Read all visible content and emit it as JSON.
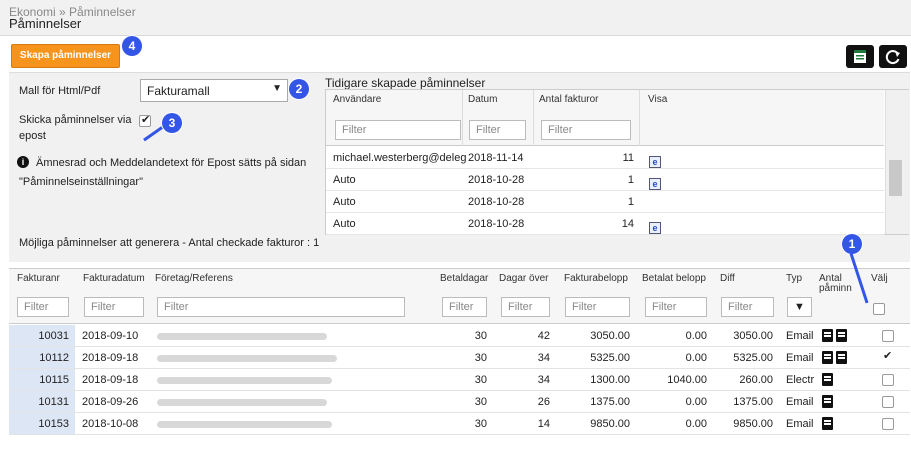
{
  "breadcrumb": "Ekonomi » Påminnelser",
  "page_title": "Påminnelser",
  "create_button": "Skapa påminnelser",
  "settings": {
    "template_label": "Mall för Html/Pdf",
    "template_value": "Fakturamall",
    "email_label_1": "Skicka påminnelser via",
    "email_label_2": "epost",
    "info_line_1": "Ämnesrad och Meddelandetext för Epost sätts på sidan",
    "info_line_2": "\"Påminnelseinställningar\"",
    "possible_label": "Möjliga påminnelser att generera - Antal checkade fakturor : 1"
  },
  "previous": {
    "title": "Tidigare skapade påminnelser",
    "columns": [
      "Användare",
      "Datum",
      "Antal fakturor",
      "Visa"
    ],
    "filter_placeholder": "Filter",
    "rows": [
      {
        "user": "michael.westerberg@deleg",
        "date": "2018-11-14",
        "count": "11",
        "icon": true
      },
      {
        "user": "Auto",
        "date": "2018-10-28",
        "count": "1",
        "icon": true
      },
      {
        "user": "Auto",
        "date": "2018-10-28",
        "count": "1",
        "icon": false
      },
      {
        "user": "Auto",
        "date": "2018-10-28",
        "count": "14",
        "icon": true
      }
    ]
  },
  "main": {
    "columns": {
      "nr": "Fakturanr",
      "date": "Fakturadatum",
      "company": "Företag/Referens",
      "paydays": "Betaldagar",
      "overdue": "Dagar över",
      "amount": "Fakturabelopp",
      "paid": "Betalat belopp",
      "diff": "Diff",
      "type": "Typ",
      "reminders_1": "Antal",
      "reminders_2": "påminn",
      "select": "Välj"
    },
    "filter_placeholder": "Filter",
    "type_filter_symbol": "▼",
    "rows": [
      {
        "nr": "10031",
        "date": "2018-09-10",
        "paydays": "30",
        "overdue": "42",
        "amount": "3050.00",
        "paid": "0.00",
        "diff": "3050.00",
        "type": "Email",
        "pdfs": 2,
        "checked": false
      },
      {
        "nr": "10112",
        "date": "2018-09-18",
        "paydays": "30",
        "overdue": "34",
        "amount": "5325.00",
        "paid": "0.00",
        "diff": "5325.00",
        "type": "Email",
        "pdfs": 2,
        "checked": true
      },
      {
        "nr": "10115",
        "date": "2018-09-18",
        "paydays": "30",
        "overdue": "34",
        "amount": "1300.00",
        "paid": "1040.00",
        "diff": "260.00",
        "type": "Electr",
        "pdfs": 1,
        "checked": false
      },
      {
        "nr": "10131",
        "date": "2018-09-26",
        "paydays": "30",
        "overdue": "26",
        "amount": "1375.00",
        "paid": "0.00",
        "diff": "1375.00",
        "type": "Email",
        "pdfs": 1,
        "checked": false
      },
      {
        "nr": "10153",
        "date": "2018-10-08",
        "paydays": "30",
        "overdue": "14",
        "amount": "9850.00",
        "paid": "0.00",
        "diff": "9850.00",
        "type": "Email",
        "pdfs": 1,
        "checked": false
      }
    ]
  },
  "badges": [
    "1",
    "2",
    "3",
    "4"
  ],
  "colors": {
    "accent": "#f7941d",
    "badge": "#3456e6",
    "row_highlight": "#dde6f4"
  }
}
